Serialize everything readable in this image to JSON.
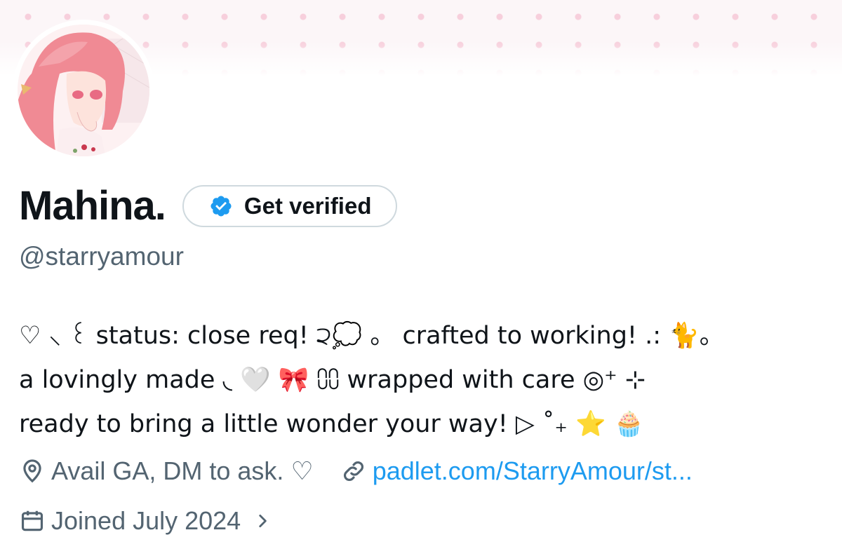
{
  "profile": {
    "display_name": "Mahina.",
    "handle": "@starryamour",
    "verify_button_label": "Get verified",
    "bio_lines": [
      "♡ ⸜ ꒰ status: close req! ੨💭 。 crafted to working! .: 🐈。",
      "a lovingly made ◟ 🤍 🎀 ⩇⩇ wrapped with care ◎⁺ ⊹",
      "ready to bring a little wonder your way! ▷ ˚₊ ⭐ 🧁"
    ],
    "location": "Avail GA, DM to ask. ♡",
    "website": "padlet.com/StarryAmour/st...",
    "joined": "Joined July 2024"
  },
  "icons": {
    "verified": "verified-badge-icon",
    "location": "location-pin-icon",
    "link": "link-icon",
    "calendar": "calendar-icon",
    "chevron": "chevron-right-icon"
  },
  "colors": {
    "verified_blue": "#1d9bf0",
    "link_blue": "#1d9bf0",
    "secondary_text": "#536471",
    "primary_text": "#0f1419",
    "banner_dots": "#f7cfdc"
  }
}
